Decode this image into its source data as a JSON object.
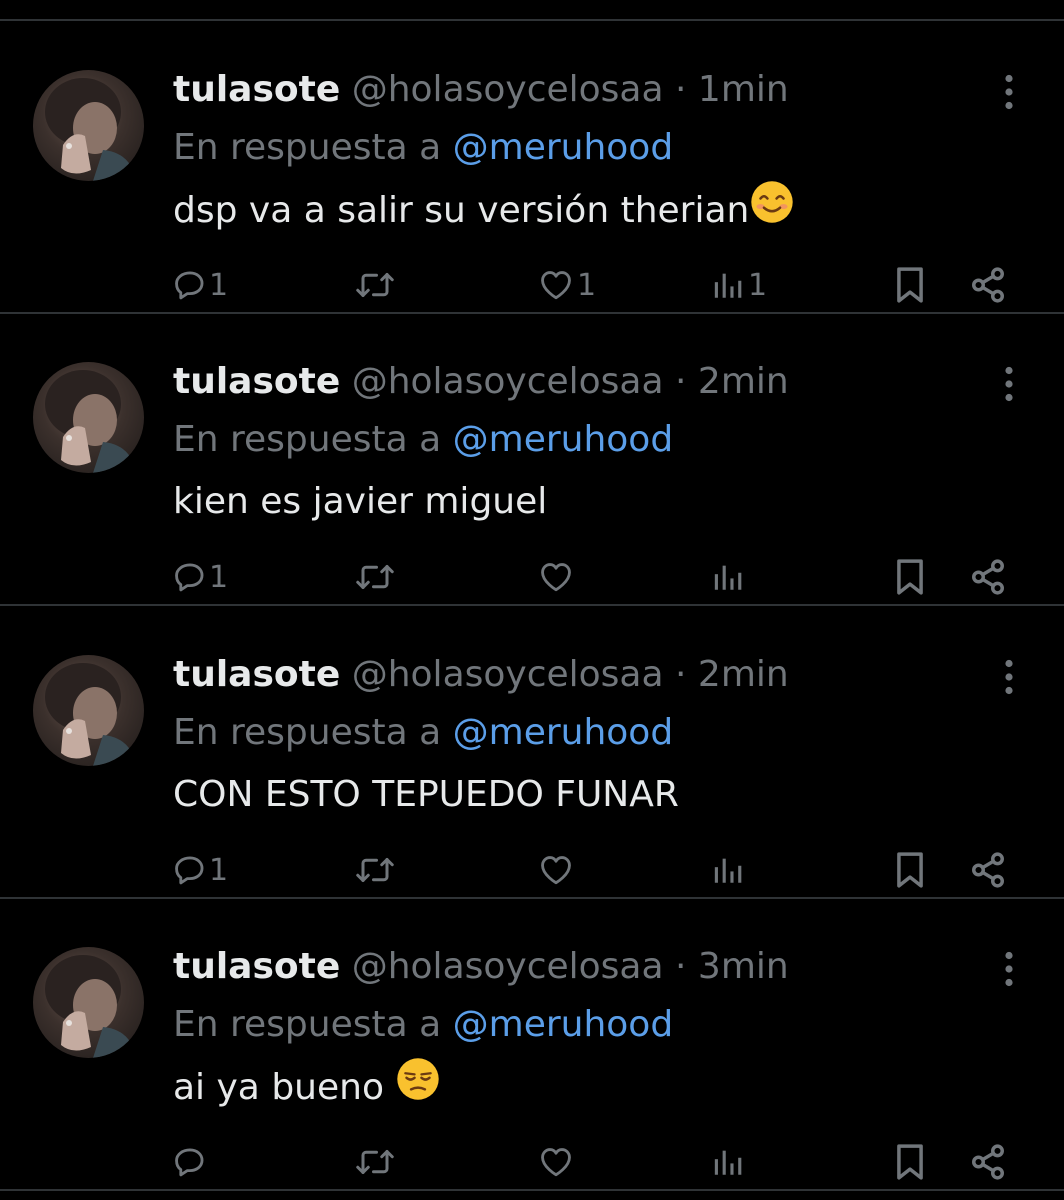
{
  "tweets": [
    {
      "display_name": "tulasote",
      "handle": "@holasoycelosaa",
      "separator": "·",
      "time": "1min",
      "reply_prefix": "En respuesta a",
      "reply_mention": "@meruhood",
      "text": "dsp va a salir su versión therian",
      "emoji": "smiling-face-icon",
      "reply_count": "1",
      "retweet_count": "",
      "like_count": "1",
      "view_count": "1"
    },
    {
      "display_name": "tulasote",
      "handle": "@holasoycelosaa",
      "separator": "·",
      "time": "2min",
      "reply_prefix": "En respuesta a",
      "reply_mention": "@meruhood",
      "text": "kien es javier miguel",
      "emoji": "",
      "reply_count": "1",
      "retweet_count": "",
      "like_count": "",
      "view_count": ""
    },
    {
      "display_name": "tulasote",
      "handle": "@holasoycelosaa",
      "separator": "·",
      "time": "2min",
      "reply_prefix": "En respuesta a",
      "reply_mention": "@meruhood",
      "text": "CON ESTO TEPUEDO FUNAR",
      "emoji": "",
      "reply_count": "1",
      "retweet_count": "",
      "like_count": "",
      "view_count": ""
    },
    {
      "display_name": "tulasote",
      "handle": "@holasoycelosaa",
      "separator": "·",
      "time": "3min",
      "reply_prefix": "En respuesta a",
      "reply_mention": "@meruhood",
      "text": "ai ya bueno ",
      "emoji": "unamused-face-icon",
      "reply_count": "",
      "retweet_count": "",
      "like_count": "",
      "view_count": ""
    }
  ],
  "icons": {
    "reply": "reply-icon",
    "retweet": "retweet-icon",
    "like": "heart-icon",
    "views": "views-icon",
    "bookmark": "bookmark-icon",
    "share": "share-icon",
    "more": "more-vertical-icon"
  },
  "colors": {
    "background": "#000000",
    "text_primary": "#e7e9ea",
    "text_secondary": "#71767b",
    "mention": "#5b9ee8",
    "divider": "#2f3336",
    "emoji": "#f9c12e"
  }
}
